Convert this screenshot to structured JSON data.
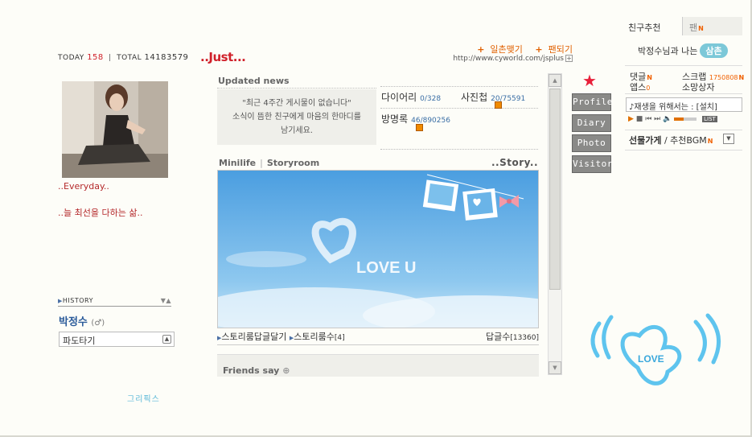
{
  "counter": {
    "today_label": "TODAY",
    "today": "158",
    "total_label": "TOTAL",
    "total": "14183579"
  },
  "title": "..Just...",
  "top_links": {
    "link1": "일촌맺기",
    "link2": "팬되기",
    "url": "http://www.cyworld.com/jsplus"
  },
  "profile": {
    "caption": "..Everyday..",
    "motto": "..늘 최선을 다하는 삶..",
    "history_label": "HISTORY",
    "name": "박정수",
    "gender": "(♂)",
    "select_value": "파도타기",
    "footer_logo": "그리픽스"
  },
  "news": {
    "label": "Updated news",
    "empty_line1": "\"최근 4주간 게시물이 없습니다\"",
    "empty_line2": "소식이 뜸한 친구에게 마음의 한마디를",
    "empty_line3": "남기세요."
  },
  "stats": {
    "diary_label": "다이어리",
    "diary": "0/328",
    "photo_label": "사진첩",
    "photo": "20/75591",
    "guest_label": "방명록",
    "guest": "46/890256"
  },
  "minilife": {
    "tab1": "Minilife",
    "tab2": "Storyroom",
    "story_label": "..Story..",
    "image_text": "LOVE U",
    "foot1": "스토리룸답글달기",
    "foot2": "스토리룸수",
    "foot2_count": "[4]",
    "foot3": "답글수",
    "foot3_count": "[13360]"
  },
  "friends_say": "Friends say",
  "side_tabs": {
    "t1": "Profile",
    "t2": "Diary",
    "t3": "Photo",
    "t4": "Visitor"
  },
  "right_panel": {
    "tab1": "친구추천",
    "tab2": "팬",
    "relation": "박정수님과 나는",
    "relation_badge": "삼촌",
    "m1": "댓글",
    "m2": "스크랩",
    "m2_count": "1750808",
    "m3": "앱스",
    "m3_count": "0",
    "m4": "소망상자",
    "bgm_notice": "♪재생을 위해서는 : [설치]",
    "player_list": "LIST",
    "gift": "선물가게",
    "gift2": "/ 추천BGM",
    "love_art": "LOVE"
  },
  "colors": {
    "accent": "#d0202a",
    "new": "#f06000",
    "link": "#3a6ea5",
    "tab": "#8a8a88"
  }
}
